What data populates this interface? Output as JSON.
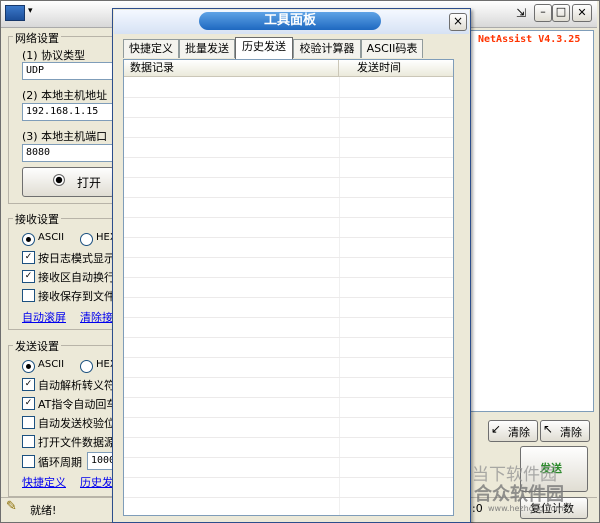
{
  "main_window": {
    "title_right_label": "NetAssist V4.3.25",
    "status_text": "就绪!",
    "status_right": ":0",
    "network": {
      "group_title": "网络设置",
      "protocol_label": "(1) 协议类型",
      "protocol_value": "UDP",
      "host_label": "(2) 本地主机地址",
      "host_value": "192.168.1.15",
      "port_label": "(3) 本地主机端口",
      "port_value": "8080",
      "open_button": "打开"
    },
    "receive": {
      "group_title": "接收设置",
      "ascii": "ASCII",
      "hex": "HEX",
      "log_mode": "按日志模式显示",
      "auto_wrap": "接收区自动换行",
      "save_file": "接收保存到文件",
      "auto_scroll": "自动滚屏",
      "clear_recv": "清除接收"
    },
    "send": {
      "group_title": "发送设置",
      "ascii": "ASCII",
      "hex": "HEX",
      "auto_escape": "自动解析转义符",
      "at_cmd": "AT指令自动回车",
      "auto_checksum": "自动发送校验位",
      "open_file": "打开文件数据源",
      "loop": "循环周期",
      "loop_value": "1000",
      "quick_def": "快捷定义",
      "history": "历史发送"
    },
    "right_buttons": {
      "clear1": "清除",
      "clear2": "清除",
      "send": "发送",
      "reset_count": "复位计数"
    },
    "watermark": "当下软件园",
    "watermark2": "合众软件园",
    "watermark_url": "www.hezhong.com"
  },
  "tool_panel": {
    "title": "工具面板",
    "close_glyph": "×",
    "tabs": [
      "快捷定义",
      "批量发送",
      "历史发送",
      "校验计算器",
      "ASCII码表"
    ],
    "active_tab": 2,
    "columns": [
      "数据记录",
      "发送时间"
    ]
  },
  "colors": {
    "accent": "#1e68c0",
    "version_red": "#ff3300",
    "send_green": "#2e8b2e"
  }
}
